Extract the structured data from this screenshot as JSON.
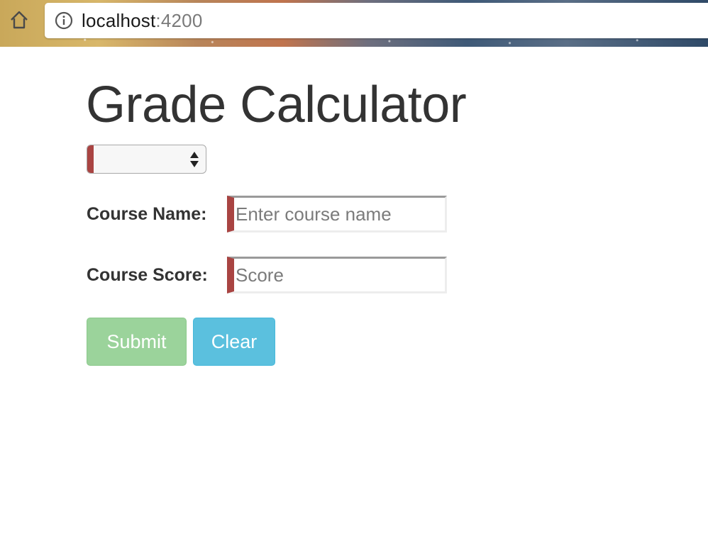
{
  "browser": {
    "url_host": "localhost",
    "url_port": ":4200",
    "home_icon": "home-icon",
    "info_icon": "info-icon"
  },
  "page": {
    "title": "Grade Calculator"
  },
  "form": {
    "select": {
      "selected_value": "",
      "arrows_icon": "select-arrows-icon"
    },
    "course_name": {
      "label": "Course Name:",
      "value": "",
      "placeholder": "Enter course name"
    },
    "course_score": {
      "label": "Course Score:",
      "value": "",
      "placeholder": "Score"
    },
    "buttons": {
      "submit_label": "Submit",
      "clear_label": "Clear"
    }
  },
  "colors": {
    "validation_red": "#a94442",
    "submit_green": "#9bd39b",
    "clear_blue": "#5bc0de",
    "text": "#333333"
  }
}
